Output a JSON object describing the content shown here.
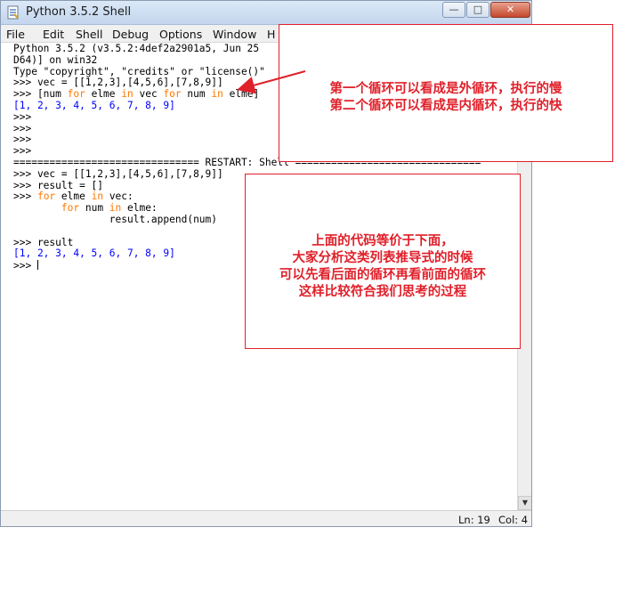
{
  "window": {
    "title": "Python 3.5.2 Shell",
    "controls": {
      "minimize": "—",
      "maximize": "□",
      "close": "✕"
    }
  },
  "menu": [
    "File",
    "Edit",
    "Shell",
    "Debug",
    "Options",
    "Window",
    "H"
  ],
  "shell": {
    "lines": [
      [
        {
          "t": "Python 3.5.2 (v3.5.2:4def2a2901a5, Jun 25 ",
          "c": ""
        }
      ],
      [
        {
          "t": "D64)] on win32",
          "c": ""
        }
      ],
      [
        {
          "t": "Type \"copyright\", \"credits\" or \"license()\"",
          "c": ""
        }
      ],
      [
        {
          "t": ">>> vec = [[1,2,3],[4,5,6],[7,8,9]]",
          "c": ""
        }
      ],
      [
        {
          "t": ">>> [num ",
          "c": ""
        },
        {
          "t": "for",
          "c": "kw"
        },
        {
          "t": " elme ",
          "c": ""
        },
        {
          "t": "in",
          "c": "kw"
        },
        {
          "t": " vec ",
          "c": ""
        },
        {
          "t": "for",
          "c": "kw"
        },
        {
          "t": " num ",
          "c": ""
        },
        {
          "t": "in",
          "c": "kw"
        },
        {
          "t": " elme]",
          "c": ""
        }
      ],
      [
        {
          "t": "[1, 2, 3, 4, 5, 6, 7, 8, 9]",
          "c": "out"
        }
      ],
      [
        {
          "t": ">>>",
          "c": ""
        }
      ],
      [
        {
          "t": ">>>",
          "c": ""
        }
      ],
      [
        {
          "t": ">>>",
          "c": ""
        }
      ],
      [
        {
          "t": ">>>",
          "c": ""
        }
      ],
      [
        {
          "t": "=============================== RESTART: Shell ===============================",
          "c": ""
        }
      ],
      [
        {
          "t": ">>> vec = [[1,2,3],[4,5,6],[7,8,9]]",
          "c": ""
        }
      ],
      [
        {
          "t": ">>> result = []",
          "c": ""
        }
      ],
      [
        {
          "t": ">>> ",
          "c": ""
        },
        {
          "t": "for",
          "c": "kw"
        },
        {
          "t": " elme ",
          "c": ""
        },
        {
          "t": "in",
          "c": "kw"
        },
        {
          "t": " vec:",
          "c": ""
        }
      ],
      [
        {
          "t": "        ",
          "c": ""
        },
        {
          "t": "for",
          "c": "kw"
        },
        {
          "t": " num ",
          "c": ""
        },
        {
          "t": "in",
          "c": "kw"
        },
        {
          "t": " elme:",
          "c": ""
        }
      ],
      [
        {
          "t": "                result.append(num)",
          "c": ""
        }
      ],
      [
        {
          "t": "",
          "c": ""
        }
      ],
      [
        {
          "t": ">>> result",
          "c": ""
        }
      ],
      [
        {
          "t": "[1, 2, 3, 4, 5, 6, 7, 8, 9]",
          "c": "out"
        }
      ],
      [
        {
          "t": ">>> ",
          "c": ""
        }
      ]
    ]
  },
  "status": {
    "line": "Ln: 19",
    "col": "Col: 4"
  },
  "annotations": {
    "callout1": [
      "第一个循环可以看成是外循环，执行的慢",
      "第二个循环可以看成是内循环，执行的快"
    ],
    "callout2": [
      "上面的代码等价于下面，",
      "大家分析这类列表推导式的时候",
      "可以先看后面的循环再看前面的循环",
      "这样比较符合我们思考的过程"
    ]
  },
  "colors": {
    "keyword": "#ff7700",
    "output": "#0000ff",
    "annotation": "#e0202a"
  },
  "icons": {
    "app": "python-idle-icon"
  }
}
